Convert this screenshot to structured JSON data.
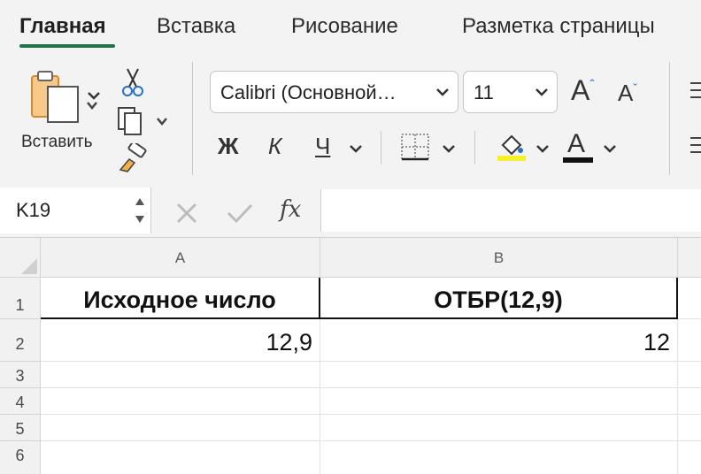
{
  "ribbon_tabs": [
    {
      "label": "Главная",
      "active": true
    },
    {
      "label": "Вставка",
      "active": false
    },
    {
      "label": "Рисование",
      "active": false
    },
    {
      "label": "Разметка страницы",
      "active": false
    }
  ],
  "clipboard": {
    "paste_label": "Вставить",
    "icons": [
      "paste-icon",
      "cut-icon",
      "copy-icon",
      "format-painter-icon"
    ]
  },
  "font": {
    "family_value": "Calibri (Основной…",
    "size_value": "11",
    "grow_label": "A",
    "shrink_label": "A",
    "bold_label": "Ж",
    "italic_label": "К",
    "underline_label": "Ч",
    "font_color_label": "A",
    "highlight_color": "#f5f02a",
    "font_color": "#111111"
  },
  "formula_bar": {
    "name_box_value": "K19",
    "fx_label": "fx",
    "formula_value": ""
  },
  "sheet": {
    "columns": [
      "A",
      "B"
    ],
    "rows": [
      "1",
      "2",
      "3",
      "4",
      "5",
      "6"
    ],
    "cells": {
      "A1": "Исходное число",
      "B1": "ОТБР(12,9)",
      "A2": "12,9",
      "B2": "12"
    }
  },
  "colors": {
    "accent_green": "#227447",
    "ribbon_bg": "#f3f3f3"
  }
}
